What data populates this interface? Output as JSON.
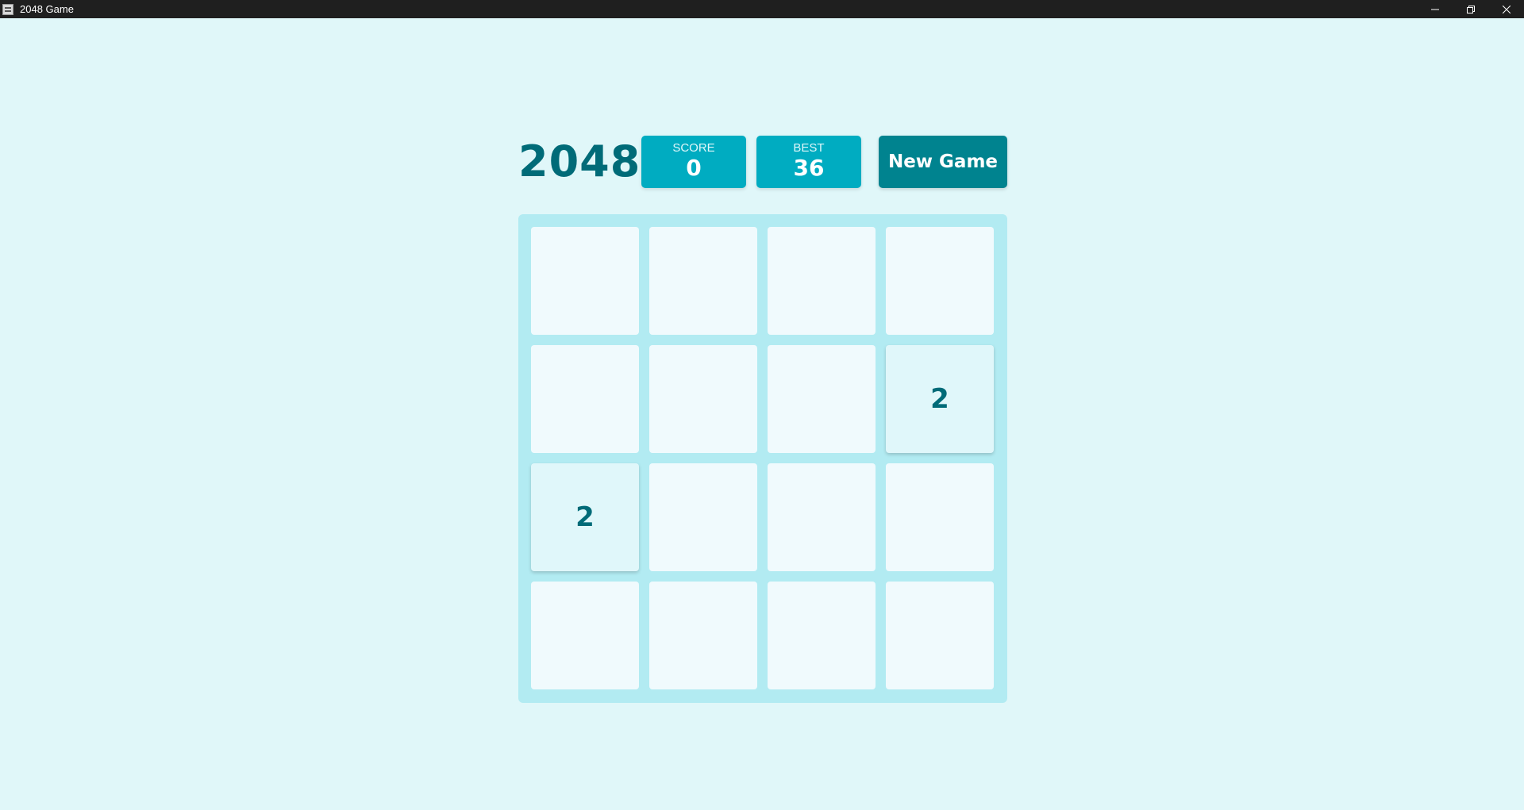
{
  "window": {
    "title": "2048 Game",
    "icon": "app-icon",
    "controls": [
      "minimize-icon",
      "restore-icon",
      "close-icon"
    ]
  },
  "game": {
    "title": "2048",
    "score_label": "SCORE",
    "score_value": "0",
    "best_label": "BEST",
    "best_value": "36",
    "new_game_label": "New Game"
  },
  "board": {
    "rows": [
      [
        "",
        "",
        "",
        ""
      ],
      [
        "",
        "",
        "",
        "2"
      ],
      [
        "2",
        "",
        "",
        ""
      ],
      [
        "",
        "",
        "",
        ""
      ]
    ]
  },
  "colors": {
    "background": "#e0f7f9",
    "accent": "#00acc1",
    "button": "#00838f",
    "text": "#006b78",
    "board": "#b2ebf2"
  }
}
